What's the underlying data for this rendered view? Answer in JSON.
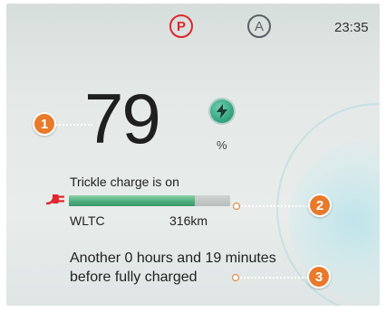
{
  "header": {
    "parking_indicator": "P",
    "auto_hold_indicator": "A",
    "time": "23:35"
  },
  "battery": {
    "level": "79",
    "unit": "%",
    "charge_status": "Trickle charge is on",
    "charge_fraction": 0.78,
    "range_standard": "WLTC",
    "range_value": "316km",
    "time_to_full_line1": "Another 0 hours and 19 minutes",
    "time_to_full_line2": "before fully charged"
  },
  "callouts": [
    "1",
    "2",
    "3"
  ],
  "colors": {
    "parking": "#e0262e",
    "charge_bar": "#4fae7c",
    "callout": "#e87a2a",
    "plug": "#e0262e"
  },
  "icons": {
    "charging": "lightning-bolt-icon",
    "plug": "charging-plug-icon"
  }
}
